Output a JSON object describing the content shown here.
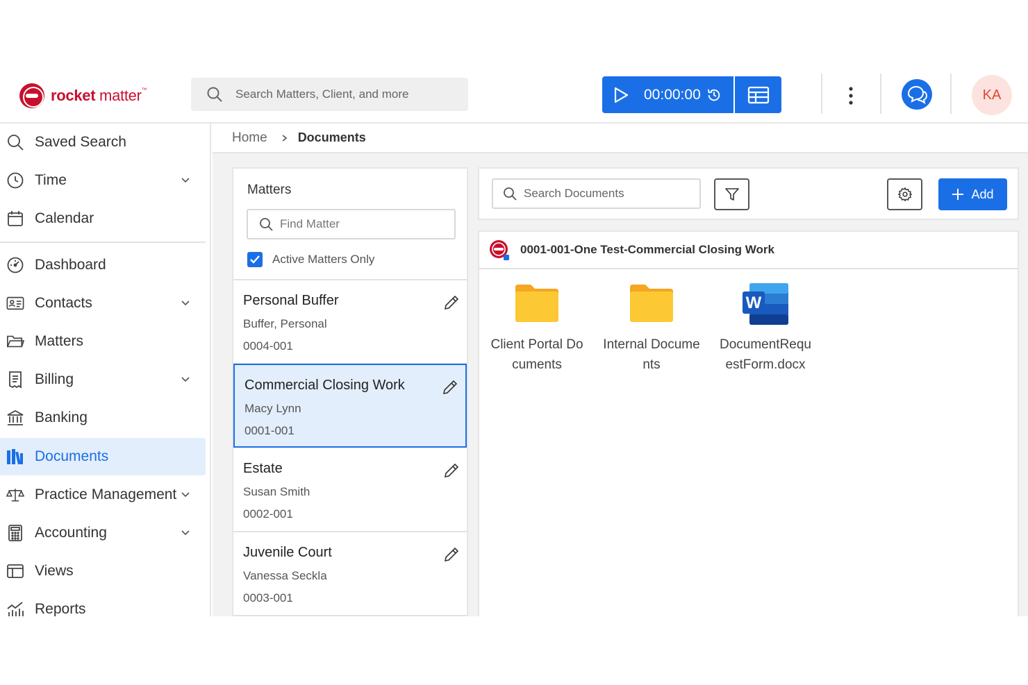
{
  "header": {
    "logo_text_bold": "rocket",
    "logo_text_light": " matter",
    "logo_tm": "™",
    "search_placeholder": "Search Matters, Client, and more",
    "timer_value": "00:00:00",
    "avatar_initials": "KA"
  },
  "sidebar": {
    "items": [
      {
        "label": "Saved Search",
        "icon": "search-icon",
        "chevron": false
      },
      {
        "label": "Time",
        "icon": "clock-icon",
        "chevron": true
      },
      {
        "label": "Calendar",
        "icon": "calendar-icon",
        "chevron": false
      },
      {
        "label": "Dashboard",
        "icon": "dashboard-icon",
        "chevron": false
      },
      {
        "label": "Contacts",
        "icon": "contacts-icon",
        "chevron": true
      },
      {
        "label": "Matters",
        "icon": "folder-icon",
        "chevron": false
      },
      {
        "label": "Billing",
        "icon": "receipt-icon",
        "chevron": true
      },
      {
        "label": "Banking",
        "icon": "bank-icon",
        "chevron": false
      },
      {
        "label": "Documents",
        "icon": "documents-icon",
        "chevron": false,
        "active": true
      },
      {
        "label": "Practice Management",
        "icon": "scales-icon",
        "chevron": true
      },
      {
        "label": "Accounting",
        "icon": "calculator-icon",
        "chevron": true
      },
      {
        "label": "Views",
        "icon": "views-icon",
        "chevron": false
      },
      {
        "label": "Reports",
        "icon": "reports-icon",
        "chevron": false
      }
    ]
  },
  "breadcrumb": {
    "home": "Home",
    "current": "Documents"
  },
  "matters": {
    "title": "Matters",
    "find_placeholder": "Find Matter",
    "active_only_label": "Active Matters Only",
    "active_only_checked": true,
    "list": [
      {
        "name": "Personal Buffer",
        "client": "Buffer, Personal",
        "number": "0004-001"
      },
      {
        "name": "Commercial Closing Work",
        "client": "Macy Lynn",
        "number": "0001-001",
        "selected": true
      },
      {
        "name": "Estate",
        "client": "Susan Smith",
        "number": "0002-001"
      },
      {
        "name": "Juvenile Court",
        "client": "Vanessa Seckla",
        "number": "0003-001"
      }
    ]
  },
  "documents": {
    "search_placeholder": "Search Documents",
    "add_label": "Add",
    "current_matter": "0001-001-One Test-Commercial Closing Work",
    "items": [
      {
        "label": "Client Portal Documents",
        "type": "folder"
      },
      {
        "label": "Internal Documents",
        "type": "folder"
      },
      {
        "label": "DocumentRequestForm.docx",
        "type": "word"
      }
    ]
  },
  "colors": {
    "brand_red": "#c8102e",
    "accent_blue": "#1a6fe6",
    "active_bg": "#e3eefc",
    "folder_yellow": "#fcc934"
  }
}
